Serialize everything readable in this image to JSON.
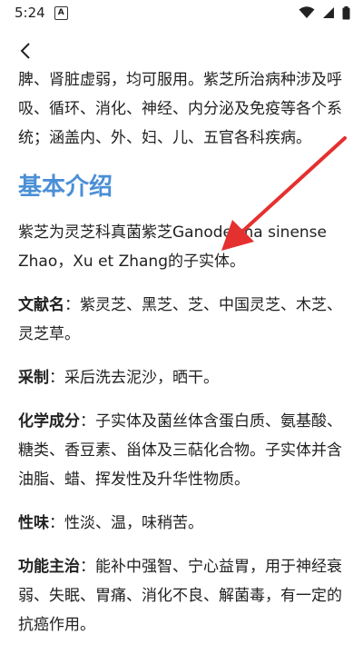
{
  "status_bar": {
    "time": "5:24",
    "notification_badge": "A"
  },
  "nav": {
    "back_icon": "chevron-left-icon"
  },
  "content": {
    "intro_paragraph": "脾、肾脏虚弱，均可服用。紫芝所治病种涉及呼吸、循环、消化、神经、内分泌及免疫等各个系统；涵盖内、外、妇、儿、五官各科疾病。",
    "section_heading": "基本介绍",
    "description": "紫芝为灵芝科真菌紫芝Ganoderma sinense Zhao，Xu et Zhang的子实体。",
    "items": [
      {
        "term": "文献名",
        "separator": "：",
        "text": "紫灵芝、黑芝、芝、中国灵芝、木芝、灵芝草。"
      },
      {
        "term": "采制",
        "separator": "：",
        "text": "采后洗去泥沙，晒干。"
      },
      {
        "term": "化学成分",
        "separator": "：",
        "text": "子实体及菌丝体含蛋白质、氨基酸、糖类、香豆素、甾体及三萜化合物。子实体并含油脂、蜡、挥发性及升华性物质。"
      },
      {
        "term": "性味",
        "separator": "：",
        "text": "性淡、温，味稍苦。"
      },
      {
        "term": "功能主治",
        "separator": "：",
        "text": "能补中强智、宁心益胃，用于神经衰弱、失眠、胃痛、消化不良、解菌毒，有一定的抗癌作用。"
      }
    ]
  },
  "colors": {
    "heading": "#4a8fd6",
    "arrow": "#e53030",
    "text": "#222222"
  }
}
